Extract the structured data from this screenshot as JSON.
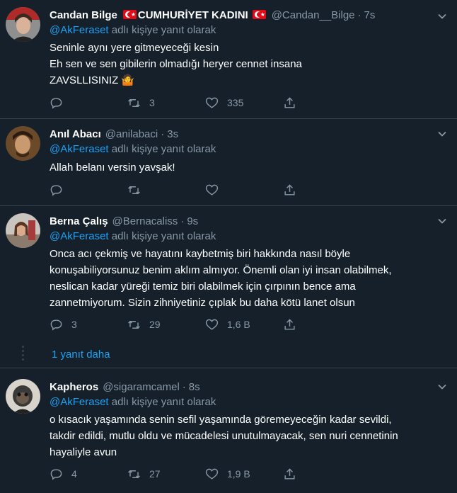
{
  "tweets": [
    {
      "name": "Candan Bilge",
      "name_suffix": "CUMHURİYET KADINI",
      "handle": "@Candan__Bilge",
      "time": "7s",
      "replying_to": "@AkFeraset",
      "replying_suffix": "adlı kişiye yanıt olarak",
      "text": "Seninle aynı yere gitmeyeceği kesin\nEh sen ve sen gibilerin olmadığı heryer cennet insana\nZAVSLLISINIZ 🤷",
      "replies": "",
      "retweets": "3",
      "likes": "335"
    },
    {
      "name": "Anıl Abacı",
      "handle": "@anilabaci",
      "time": "3s",
      "replying_to": "@AkFeraset",
      "replying_suffix": "adlı kişiye yanıt olarak",
      "text": "Allah belanı versin yavşak!",
      "replies": "",
      "retweets": "",
      "likes": ""
    },
    {
      "name": "Berna Çalış",
      "handle": "@Bernacaliss",
      "time": "9s",
      "replying_to": "@AkFeraset",
      "replying_suffix": "adlı kişiye yanıt olarak",
      "text": "Onca acı çekmiş ve hayatını kaybetmiş biri hakkında nasıl böyle\nkonuşabiliyorsunuz benim aklım almıyor. Önemli olan iyi insan olabilmek,\nneslican kadar yüreği temiz biri olabilmek için çırpının bence ama\nzannetmiyorum. Sizin zihniyetiniz çıplak bu daha kötü lanet olsun",
      "replies": "3",
      "retweets": "29",
      "likes": "1,6 B"
    },
    {
      "name": "Kapheros",
      "handle": "@sigaramcamel",
      "time": "8s",
      "replying_to": "@AkFeraset",
      "replying_suffix": "adlı kişiye yanıt olarak",
      "text": "o kısacık yaşamında senin sefil yaşamında göremeyeceğin kadar sevildi,\ntakdir edildi, mutlu oldu ve mücadelesi unutulmayacak,  sen nuri cennetinin\nhayaliyle avun",
      "replies": "4",
      "retweets": "27",
      "likes": "1,9 B"
    }
  ],
  "more_replies_label": "1 yanıt daha",
  "colors": {
    "background": "#15202b",
    "border": "#38444d",
    "secondary_text": "#8899a6",
    "accent": "#1da1f2"
  },
  "icons": [
    "reply-icon",
    "retweet-icon",
    "like-icon",
    "share-icon",
    "chevron-down-icon",
    "turkish-flag-icon"
  ]
}
